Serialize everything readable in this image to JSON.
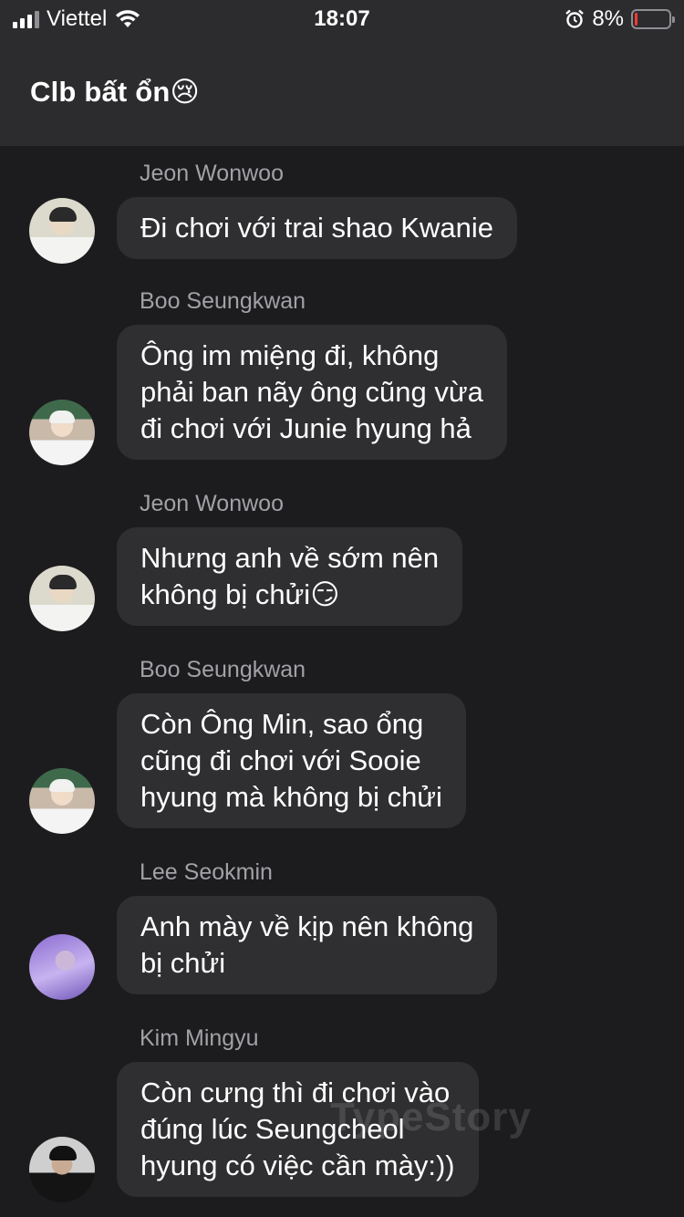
{
  "status_bar": {
    "carrier": "Viettel",
    "time": "18:07",
    "battery_percent": "8%",
    "battery_level": 0.08,
    "icons": [
      "signal-icon",
      "wifi-icon",
      "alarm-icon",
      "battery-icon"
    ]
  },
  "header": {
    "title": "Clb bất ổn😢"
  },
  "messages": [
    {
      "sender": "Jeon Wonwoo",
      "lines": [
        "Đi chơi với trai shao Kwanie"
      ]
    },
    {
      "sender": "Boo Seungkwan",
      "lines": [
        "Ông im miệng đi, không",
        "phải ban nãy ông cũng vừa",
        "đi chơi với Junie hyung hả"
      ]
    },
    {
      "sender": "Jeon Wonwoo",
      "lines": [
        "Nhưng anh về sớm nên",
        "không bị chửi😏"
      ]
    },
    {
      "sender": "Boo Seungkwan",
      "lines": [
        "Còn Ông Min, sao ổng",
        "cũng đi chơi với Sooie",
        "hyung mà không bị chửi"
      ]
    },
    {
      "sender": "Lee Seokmin",
      "lines": [
        "Anh mày về kịp nên không",
        "bị chửi"
      ]
    },
    {
      "sender": "Kim Mingyu",
      "lines": [
        "Còn cưng thì đi chơi vào",
        "đúng lúc Seungcheol",
        "hyung có việc cần mày:))"
      ]
    }
  ],
  "watermark": "TypeStory"
}
